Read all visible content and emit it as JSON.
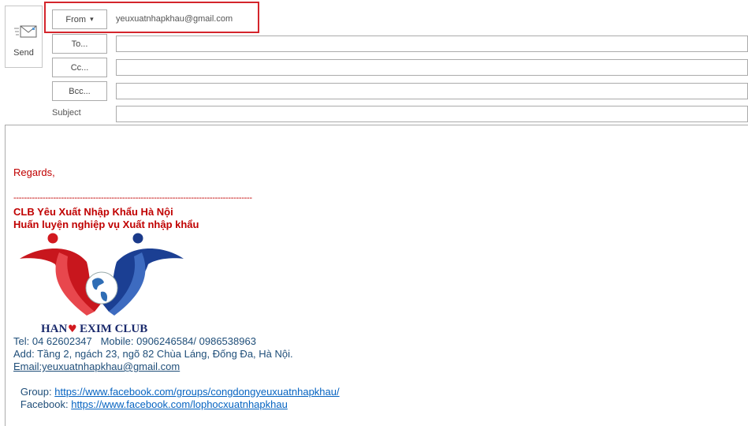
{
  "send": {
    "label": "Send",
    "icon": "send-envelope-icon"
  },
  "header": {
    "from_label": "From",
    "from_arrow": "▾",
    "from_value": "yeuxuatnhapkhau@gmail.com",
    "to_label": "To...",
    "cc_label": "Cc...",
    "bcc_label": "Bcc...",
    "subject_label": "Subject",
    "highlight_color": "#d4252c"
  },
  "signature": {
    "regards": "Regards,",
    "divider": "------------------------------------------------------------------------------------------",
    "club_name": "CLB Yêu Xuất Nhập Khẩu Hà Nội",
    "tagline": "Huấn luyện nghiệp vụ Xuất nhập khẩu",
    "logo_text_left": "HAN",
    "logo_text_right": "EXIM CLUB",
    "tel": "Tel: 04 62602347   Mobile: 0906246584/ 0986538963",
    "address": "Add: Tầng 2, ngách 23, ngõ 82 Chùa Láng, Đống Đa, Hà Nội.",
    "email": "Email:yeuxuatnhapkhau@gmail.com",
    "group_label": "Group: ",
    "group_link": "https://www.facebook.com/groups/congdongyeuxuatnhapkhau/",
    "facebook_label": "Facebook: ",
    "facebook_link": "https://www.facebook.com/lophocxuatnhapkhau"
  }
}
